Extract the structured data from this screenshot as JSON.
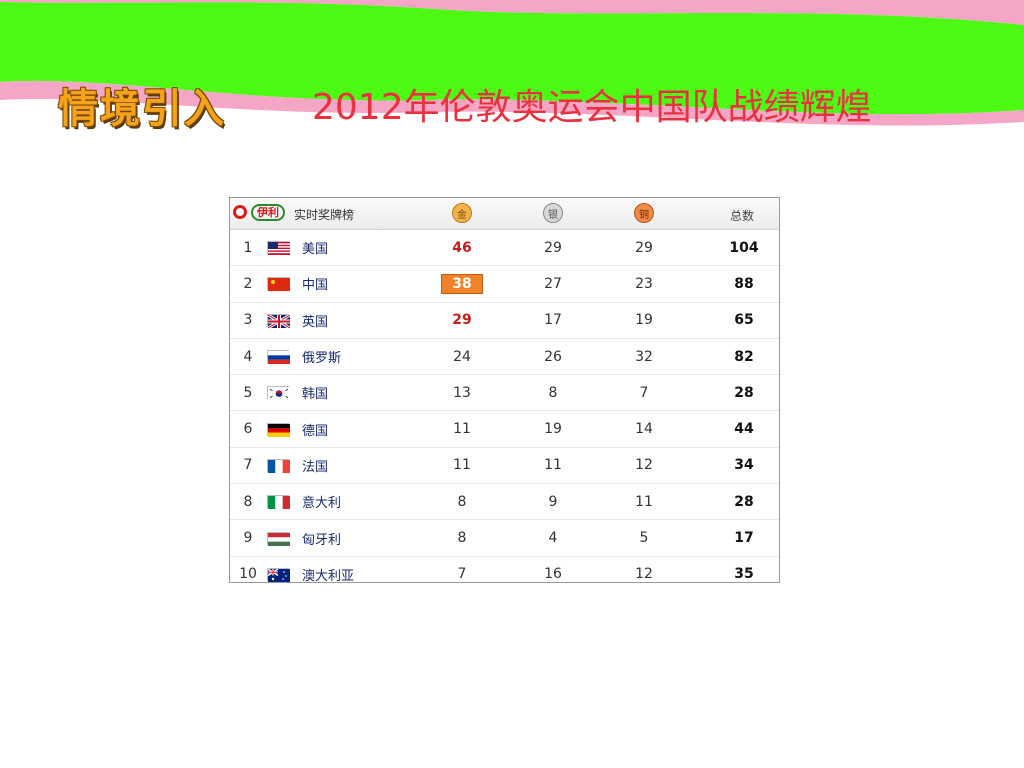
{
  "slide": {
    "label": "情境引入",
    "title": "2012年伦敦奥运会中国队战绩辉煌"
  },
  "colors": {
    "green": "#4cfa13",
    "pink": "#f5a0c4",
    "title_red": "#ea3140",
    "gold_highlight": "#f0822a"
  },
  "table": {
    "header": {
      "title": "实时奖牌榜",
      "logo_text": "伊利",
      "gold_icon": "金",
      "silver_icon": "银",
      "bronze_icon": "铜",
      "total_label": "总数"
    },
    "rows": [
      {
        "rank": "1",
        "country": "美国",
        "flag": "us-flag-icon",
        "gold": "46",
        "silver": "29",
        "bronze": "29",
        "total": "104"
      },
      {
        "rank": "2",
        "country": "中国",
        "flag": "cn-flag-icon",
        "gold": "38",
        "silver": "27",
        "bronze": "23",
        "total": "88"
      },
      {
        "rank": "3",
        "country": "英国",
        "flag": "gb-flag-icon",
        "gold": "29",
        "silver": "17",
        "bronze": "19",
        "total": "65"
      },
      {
        "rank": "4",
        "country": "俄罗斯",
        "flag": "ru-flag-icon",
        "gold": "24",
        "silver": "26",
        "bronze": "32",
        "total": "82"
      },
      {
        "rank": "5",
        "country": "韩国",
        "flag": "kr-flag-icon",
        "gold": "13",
        "silver": "8",
        "bronze": "7",
        "total": "28"
      },
      {
        "rank": "6",
        "country": "德国",
        "flag": "de-flag-icon",
        "gold": "11",
        "silver": "19",
        "bronze": "14",
        "total": "44"
      },
      {
        "rank": "7",
        "country": "法国",
        "flag": "fr-flag-icon",
        "gold": "11",
        "silver": "11",
        "bronze": "12",
        "total": "34"
      },
      {
        "rank": "8",
        "country": "意大利",
        "flag": "it-flag-icon",
        "gold": "8",
        "silver": "9",
        "bronze": "11",
        "total": "28"
      },
      {
        "rank": "9",
        "country": "匈牙利",
        "flag": "hu-flag-icon",
        "gold": "8",
        "silver": "4",
        "bronze": "5",
        "total": "17"
      },
      {
        "rank": "10",
        "country": "澳大利亚",
        "flag": "au-flag-icon",
        "gold": "7",
        "silver": "16",
        "bronze": "12",
        "total": "35"
      }
    ]
  }
}
